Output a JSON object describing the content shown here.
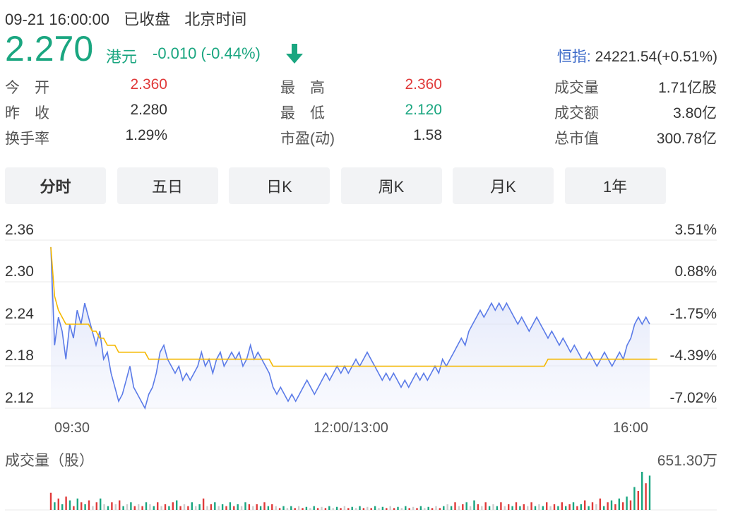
{
  "header": {
    "datetime": "09-21 16:00:00",
    "status": "已收盘",
    "timezone": "北京时间"
  },
  "quote": {
    "price": "2.270",
    "currency": "港元",
    "change": "-0.010 (-0.44%)",
    "direction_icon": "down-arrow-icon",
    "color_down": "#1aa680",
    "color_up": "#e03a3a"
  },
  "index": {
    "label": "恒指:",
    "value": "24221.54(+0.51%)"
  },
  "stats": [
    {
      "label": "今　开",
      "value": "2.360",
      "color": "red"
    },
    {
      "label": "昨　收",
      "value": "2.280",
      "color": "gray"
    },
    {
      "label": "换手率",
      "value": "1.29%",
      "color": "gray"
    },
    {
      "label": "最　高",
      "value": "2.360",
      "color": "red"
    },
    {
      "label": "最　低",
      "value": "2.120",
      "color": "green"
    },
    {
      "label": "市盈(动)",
      "value": "1.58",
      "color": "gray"
    },
    {
      "label": "成交量",
      "value": "1.71亿股",
      "color": "gray"
    },
    {
      "label": "成交额",
      "value": "3.80亿",
      "color": "gray"
    },
    {
      "label": "总市值",
      "value": "300.78亿",
      "color": "gray"
    }
  ],
  "tabs": [
    {
      "label": "分时",
      "active": true
    },
    {
      "label": "五日",
      "active": false
    },
    {
      "label": "日K",
      "active": false
    },
    {
      "label": "周K",
      "active": false
    },
    {
      "label": "月K",
      "active": false
    },
    {
      "label": "1年",
      "active": false
    }
  ],
  "chart_data": {
    "type": "line",
    "x_labels": [
      "09:30",
      "12:00/13:00",
      "16:00"
    ],
    "y_ticks": [
      "2.36",
      "2.30",
      "2.24",
      "2.18",
      "2.12"
    ],
    "y_right_ticks": [
      "3.51%",
      "0.88%",
      "-1.75%",
      "-4.39%",
      "-7.02%"
    ],
    "ylim": [
      2.12,
      2.36
    ],
    "price_color": "#5b7be8",
    "avg_color": "#f5b800",
    "series": [
      {
        "values": [
          2.35,
          2.21,
          2.25,
          2.23,
          2.19,
          2.24,
          2.22,
          2.26,
          2.24,
          2.27,
          2.25,
          2.23,
          2.21,
          2.23,
          2.19,
          2.2,
          2.17,
          2.15,
          2.13,
          2.14,
          2.16,
          2.18,
          2.15,
          2.14,
          2.13,
          2.12,
          2.14,
          2.15,
          2.17,
          2.2,
          2.21,
          2.19,
          2.18,
          2.17,
          2.18,
          2.16,
          2.17,
          2.16,
          2.17,
          2.18,
          2.2,
          2.18,
          2.19,
          2.17,
          2.19,
          2.2,
          2.18,
          2.19,
          2.2,
          2.19,
          2.2,
          2.18,
          2.19,
          2.21,
          2.19,
          2.2,
          2.19,
          2.18,
          2.17,
          2.15,
          2.14,
          2.15,
          2.14,
          2.13,
          2.14,
          2.13,
          2.14,
          2.15,
          2.16,
          2.15,
          2.14,
          2.15,
          2.16,
          2.17,
          2.16,
          2.17,
          2.18,
          2.17,
          2.18,
          2.17,
          2.18,
          2.19,
          2.18,
          2.19,
          2.2,
          2.19,
          2.18,
          2.17,
          2.16,
          2.17,
          2.16,
          2.17,
          2.16,
          2.15,
          2.16,
          2.15,
          2.16,
          2.17,
          2.16,
          2.17,
          2.16,
          2.17,
          2.18,
          2.17,
          2.19,
          2.18,
          2.19,
          2.2,
          2.21,
          2.22,
          2.21,
          2.23,
          2.24,
          2.25,
          2.26,
          2.25,
          2.26,
          2.27,
          2.26,
          2.27,
          2.26,
          2.27,
          2.26,
          2.25,
          2.24,
          2.25,
          2.24,
          2.23,
          2.24,
          2.25,
          2.24,
          2.23,
          2.22,
          2.23,
          2.22,
          2.21,
          2.22,
          2.21,
          2.2,
          2.21,
          2.2,
          2.19,
          2.19,
          2.2,
          2.19,
          2.18,
          2.19,
          2.2,
          2.19,
          2.18,
          2.19,
          2.2,
          2.19,
          2.21,
          2.22,
          2.24,
          2.25,
          2.24,
          2.25,
          2.24
        ]
      },
      {
        "values": [
          2.35,
          2.28,
          2.26,
          2.25,
          2.24,
          2.24,
          2.24,
          2.24,
          2.24,
          2.24,
          2.24,
          2.23,
          2.23,
          2.22,
          2.22,
          2.21,
          2.21,
          2.21,
          2.2,
          2.2,
          2.2,
          2.2,
          2.2,
          2.2,
          2.2,
          2.2,
          2.19,
          2.19,
          2.19,
          2.19,
          2.19,
          2.19,
          2.19,
          2.19,
          2.19,
          2.19,
          2.19,
          2.19,
          2.19,
          2.19,
          2.19,
          2.19,
          2.19,
          2.19,
          2.19,
          2.19,
          2.19,
          2.19,
          2.19,
          2.19,
          2.19,
          2.19,
          2.19,
          2.19,
          2.19,
          2.19,
          2.19,
          2.19,
          2.19,
          2.18,
          2.18,
          2.18,
          2.18,
          2.18,
          2.18,
          2.18,
          2.18,
          2.18,
          2.18,
          2.18,
          2.18,
          2.18,
          2.18,
          2.18,
          2.18,
          2.18,
          2.18,
          2.18,
          2.18,
          2.18,
          2.18,
          2.18,
          2.18,
          2.18,
          2.18,
          2.18,
          2.18,
          2.18,
          2.18,
          2.18,
          2.18,
          2.18,
          2.18,
          2.18,
          2.18,
          2.18,
          2.18,
          2.18,
          2.18,
          2.18,
          2.18,
          2.18,
          2.18,
          2.18,
          2.18,
          2.18,
          2.18,
          2.18,
          2.18,
          2.18,
          2.18,
          2.18,
          2.18,
          2.18,
          2.18,
          2.18,
          2.18,
          2.18,
          2.18,
          2.18,
          2.18,
          2.18,
          2.18,
          2.18,
          2.18,
          2.18,
          2.18,
          2.18,
          2.18,
          2.18,
          2.18,
          2.18,
          2.19,
          2.19,
          2.19,
          2.19,
          2.19,
          2.19,
          2.19,
          2.19,
          2.19,
          2.19,
          2.19,
          2.19,
          2.19,
          2.19,
          2.19,
          2.19,
          2.19,
          2.19,
          2.19,
          2.19,
          2.19,
          2.19,
          2.19,
          2.19,
          2.19,
          2.19,
          2.19,
          2.19,
          2.19,
          2.19
        ]
      }
    ],
    "volume": {
      "label": "成交量（股）",
      "max_label": "651.30万",
      "bars": [
        0.45,
        0.2,
        0.3,
        0.15,
        0.35,
        0.25,
        0.1,
        0.3,
        0.2,
        0.15,
        0.25,
        0.1,
        0.2,
        0.3,
        0.15,
        0.1,
        0.2,
        0.15,
        0.25,
        0.1,
        0.15,
        0.2,
        0.1,
        0.15,
        0.1,
        0.2,
        0.15,
        0.1,
        0.2,
        0.1,
        0.15,
        0.1,
        0.2,
        0.25,
        0.1,
        0.15,
        0.1,
        0.2,
        0.1,
        0.15,
        0.3,
        0.1,
        0.15,
        0.2,
        0.1,
        0.15,
        0.1,
        0.2,
        0.1,
        0.15,
        0.1,
        0.2,
        0.15,
        0.1,
        0.15,
        0.1,
        0.2,
        0.1,
        0.15,
        0.1,
        0.05,
        0.1,
        0.05,
        0.1,
        0.05,
        0.1,
        0.05,
        0.08,
        0.05,
        0.1,
        0.05,
        0.08,
        0.05,
        0.1,
        0.05,
        0.08,
        0.05,
        0.1,
        0.05,
        0.08,
        0.05,
        0.1,
        0.05,
        0.08,
        0.05,
        0.1,
        0.05,
        0.08,
        0.05,
        0.1,
        0.05,
        0.08,
        0.05,
        0.1,
        0.05,
        0.08,
        0.05,
        0.1,
        0.05,
        0.08,
        0.05,
        0.1,
        0.05,
        0.1,
        0.15,
        0.1,
        0.2,
        0.1,
        0.15,
        0.2,
        0.1,
        0.25,
        0.15,
        0.1,
        0.2,
        0.1,
        0.15,
        0.1,
        0.2,
        0.1,
        0.15,
        0.1,
        0.2,
        0.1,
        0.15,
        0.1,
        0.2,
        0.1,
        0.15,
        0.1,
        0.2,
        0.1,
        0.15,
        0.1,
        0.2,
        0.1,
        0.15,
        0.2,
        0.1,
        0.15,
        0.25,
        0.1,
        0.2,
        0.15,
        0.3,
        0.1,
        0.2,
        0.25,
        0.15,
        0.3,
        0.2,
        0.35,
        0.25,
        0.6,
        0.5,
        1.0,
        0.7,
        0.9
      ],
      "colors": [
        "#e03a3a",
        "#1aa680",
        "#cccccc"
      ]
    }
  }
}
